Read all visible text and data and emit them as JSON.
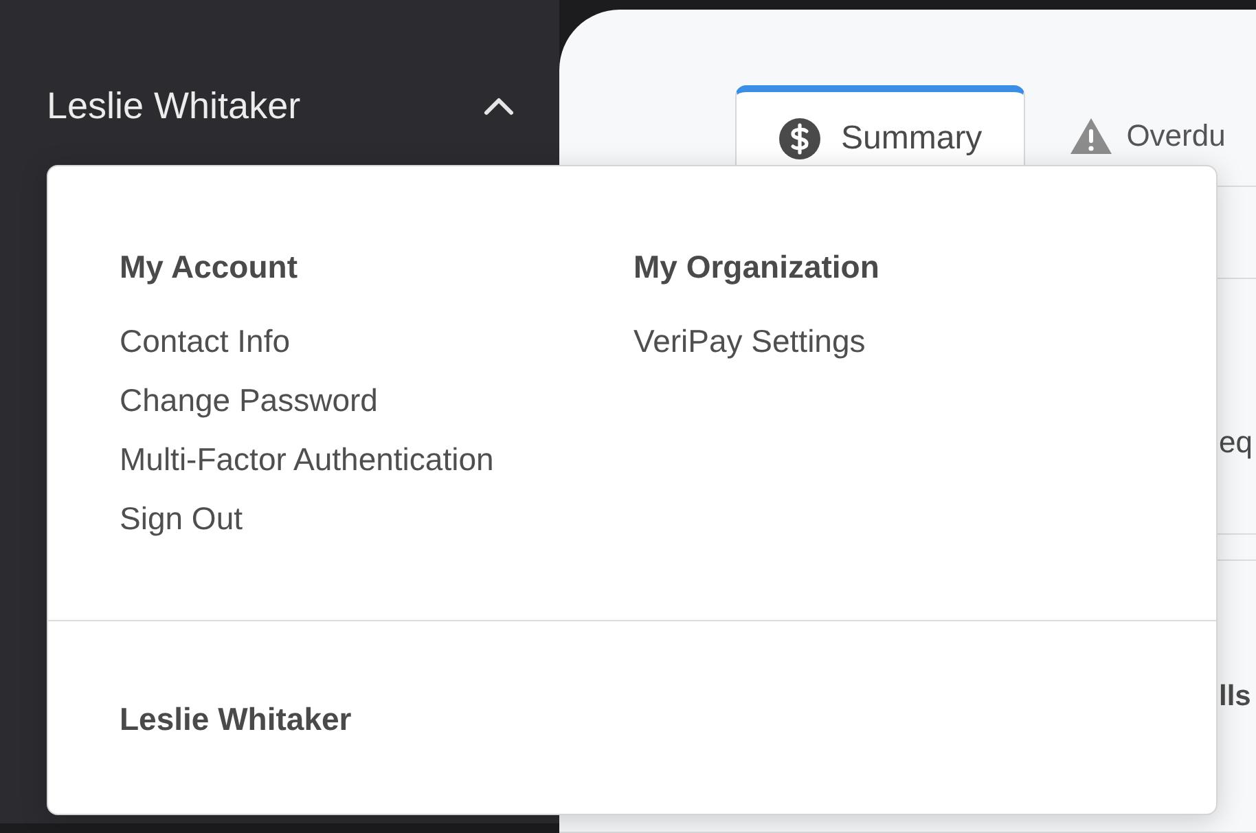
{
  "sidebar": {
    "user_name": "Leslie Whitaker",
    "menu_expanded": true
  },
  "tabs": [
    {
      "label": "Summary",
      "kind": "dollar",
      "selected": true
    },
    {
      "label": "Overdu",
      "kind": "warning",
      "selected": false
    }
  ],
  "content_rows": [
    {
      "text": "eq",
      "bold": false
    },
    {
      "text": "lls",
      "bold": true
    }
  ],
  "account_menu": {
    "columns": [
      {
        "heading": "My Account",
        "items": [
          "Contact Info",
          "Change Password",
          "Multi-Factor Authentication",
          "Sign Out"
        ]
      },
      {
        "heading": "My Organization",
        "items": [
          "VeriPay Settings"
        ]
      }
    ],
    "footer_name": "Leslie Whitaker"
  }
}
